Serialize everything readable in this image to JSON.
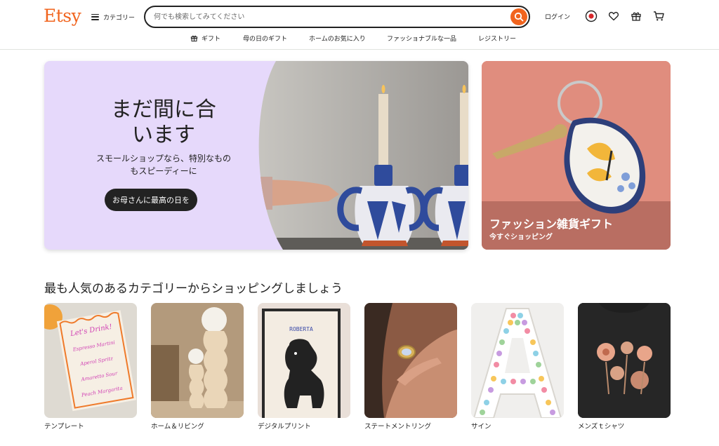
{
  "header": {
    "logo": "Etsy",
    "categories_label": "カテゴリー",
    "search_placeholder": "何でも検索してみてください",
    "login_label": "ログイン",
    "accent": "#f1641e"
  },
  "subnav": {
    "items": [
      {
        "label": "ギフト",
        "icon": "gift-icon"
      },
      {
        "label": "母の日のギフト"
      },
      {
        "label": "ホームのお気に入り"
      },
      {
        "label": "ファッショナブルな一品"
      },
      {
        "label": "レジストリー"
      }
    ]
  },
  "hero": {
    "title": "まだ間に合います",
    "subtitle": "スモールショップなら、特別なものもスピーディーに",
    "button": "お母さんに最高の日を",
    "background": "#e6d9fb"
  },
  "promo": {
    "title": "ファッション雑貨ギフト",
    "subtitle": "今すぐショッピング",
    "background": "#e28f7f"
  },
  "section": {
    "title": "最も人気のあるカテゴリーからショッピングしましょう"
  },
  "categories": [
    {
      "name": "テンプレート"
    },
    {
      "name": "ホーム＆リビング"
    },
    {
      "name": "デジタルプリント",
      "poster_text": "ROBERTA"
    },
    {
      "name": "ステートメントリング"
    },
    {
      "name": "サイン"
    },
    {
      "name": "メンズｔシャツ"
    }
  ],
  "card_template": {
    "lines": [
      "Let's Drink!",
      "Espresso Martini",
      "Aperol Spritz",
      "Amaretto Sour",
      "Peach Margarita"
    ]
  }
}
